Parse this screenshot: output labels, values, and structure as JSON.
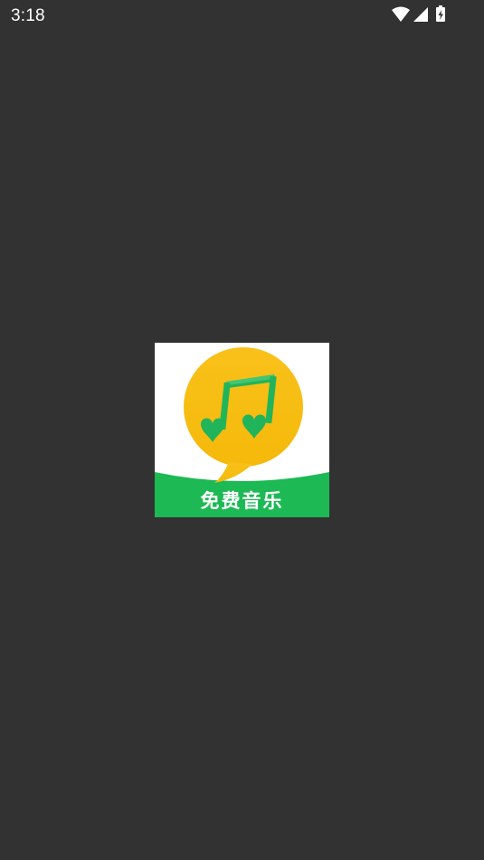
{
  "status_bar": {
    "time": "3:18",
    "icons": [
      "wifi-icon",
      "cellular-signal-icon",
      "battery-charging-icon"
    ]
  },
  "splash": {
    "app_label": "免费音乐",
    "icon": "music-note-speech-bubble-icon",
    "colors": {
      "background": "#323232",
      "bubble_yellow": "#F7C10F",
      "brand_green": "#1DB954",
      "note_green": "#22B45A",
      "logo_background": "#FFFFFF"
    }
  }
}
